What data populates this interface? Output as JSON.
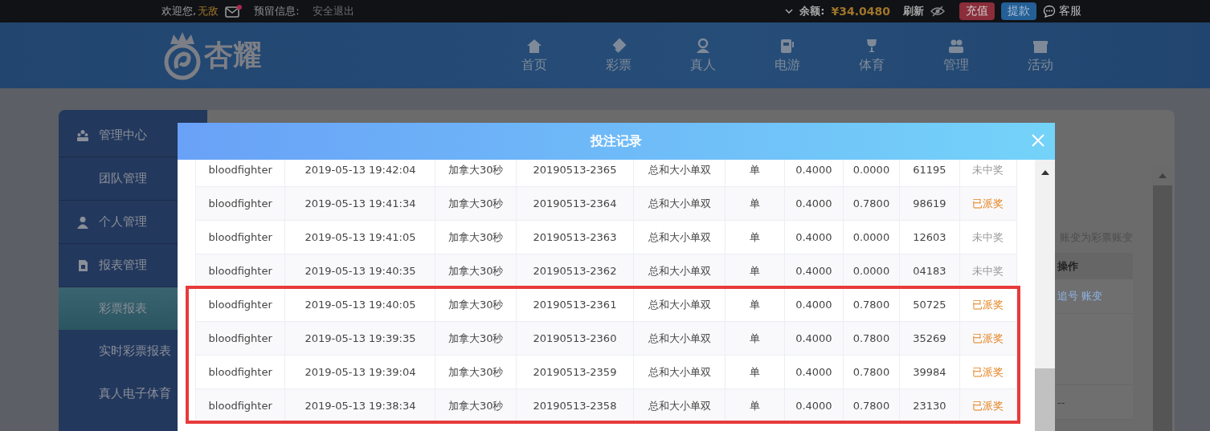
{
  "top_bar": {
    "welcome": "欢迎您,",
    "username": "无敌",
    "mail_unread": true,
    "reserved_info_label": "预留信息:",
    "logout": "安全退出",
    "balance_label": "余额:",
    "balance": "¥34.0480",
    "refresh": "刷新",
    "deposit": "充值",
    "withdraw": "提款",
    "support": "客服"
  },
  "header": {
    "logo_text": "杏耀",
    "nav": [
      {
        "label": "首页",
        "kind": "home"
      },
      {
        "label": "彩票",
        "kind": "lottery"
      },
      {
        "label": "真人",
        "kind": "live"
      },
      {
        "label": "电游",
        "kind": "slots"
      },
      {
        "label": "体育",
        "kind": "sports"
      },
      {
        "label": "管理",
        "kind": "manage"
      },
      {
        "label": "活动",
        "kind": "events"
      }
    ]
  },
  "sidebar": {
    "items": [
      {
        "label": "管理中心",
        "kind": "team",
        "selected": false
      },
      {
        "label": "团队管理",
        "kind": "sub",
        "selected": false
      },
      {
        "label": "个人管理",
        "kind": "user",
        "selected": false
      },
      {
        "label": "报表管理",
        "kind": "report",
        "selected": false
      },
      {
        "label": "彩票报表",
        "kind": "sub",
        "selected": true
      },
      {
        "label": "实时彩票报表",
        "kind": "sub",
        "selected": false
      },
      {
        "label": "真人电子体育",
        "kind": "sub",
        "selected": false
      }
    ]
  },
  "page": {
    "notice": "账变为彩票账变",
    "table_header": "操作",
    "links": [
      "追号",
      "账变"
    ],
    "empty_cell": "--"
  },
  "modal": {
    "title": "投注记录",
    "rows": [
      {
        "user": "bloodfighter",
        "time": "2019-05-13 19:42:04",
        "game": "加拿大30秒",
        "issue": "20190513-2365",
        "play": "总和大小单双",
        "bet": "单",
        "amount": "0.4000",
        "payout": "0.0000",
        "number": "61195",
        "status": "未中奖",
        "kind": "lost"
      },
      {
        "user": "bloodfighter",
        "time": "2019-05-13 19:41:34",
        "game": "加拿大30秒",
        "issue": "20190513-2364",
        "play": "总和大小单双",
        "bet": "单",
        "amount": "0.4000",
        "payout": "0.7800",
        "number": "98619",
        "status": "已派奖",
        "kind": "paid"
      },
      {
        "user": "bloodfighter",
        "time": "2019-05-13 19:41:05",
        "game": "加拿大30秒",
        "issue": "20190513-2363",
        "play": "总和大小单双",
        "bet": "单",
        "amount": "0.4000",
        "payout": "0.0000",
        "number": "12603",
        "status": "未中奖",
        "kind": "lost"
      },
      {
        "user": "bloodfighter",
        "time": "2019-05-13 19:40:35",
        "game": "加拿大30秒",
        "issue": "20190513-2362",
        "play": "总和大小单双",
        "bet": "单",
        "amount": "0.4000",
        "payout": "0.0000",
        "number": "04183",
        "status": "未中奖",
        "kind": "lost"
      },
      {
        "user": "bloodfighter",
        "time": "2019-05-13 19:40:05",
        "game": "加拿大30秒",
        "issue": "20190513-2361",
        "play": "总和大小单双",
        "bet": "单",
        "amount": "0.4000",
        "payout": "0.7800",
        "number": "50725",
        "status": "已派奖",
        "kind": "paid"
      },
      {
        "user": "bloodfighter",
        "time": "2019-05-13 19:39:35",
        "game": "加拿大30秒",
        "issue": "20190513-2360",
        "play": "总和大小单双",
        "bet": "单",
        "amount": "0.4000",
        "payout": "0.7800",
        "number": "35269",
        "status": "已派奖",
        "kind": "paid"
      },
      {
        "user": "bloodfighter",
        "time": "2019-05-13 19:39:04",
        "game": "加拿大30秒",
        "issue": "20190513-2359",
        "play": "总和大小单双",
        "bet": "单",
        "amount": "0.4000",
        "payout": "0.7800",
        "number": "39984",
        "status": "已派奖",
        "kind": "paid"
      },
      {
        "user": "bloodfighter",
        "time": "2019-05-13 19:38:34",
        "game": "加拿大30秒",
        "issue": "20190513-2358",
        "play": "总和大小单双",
        "bet": "单",
        "amount": "0.4000",
        "payout": "0.7800",
        "number": "23130",
        "status": "已派奖",
        "kind": "paid"
      }
    ]
  }
}
